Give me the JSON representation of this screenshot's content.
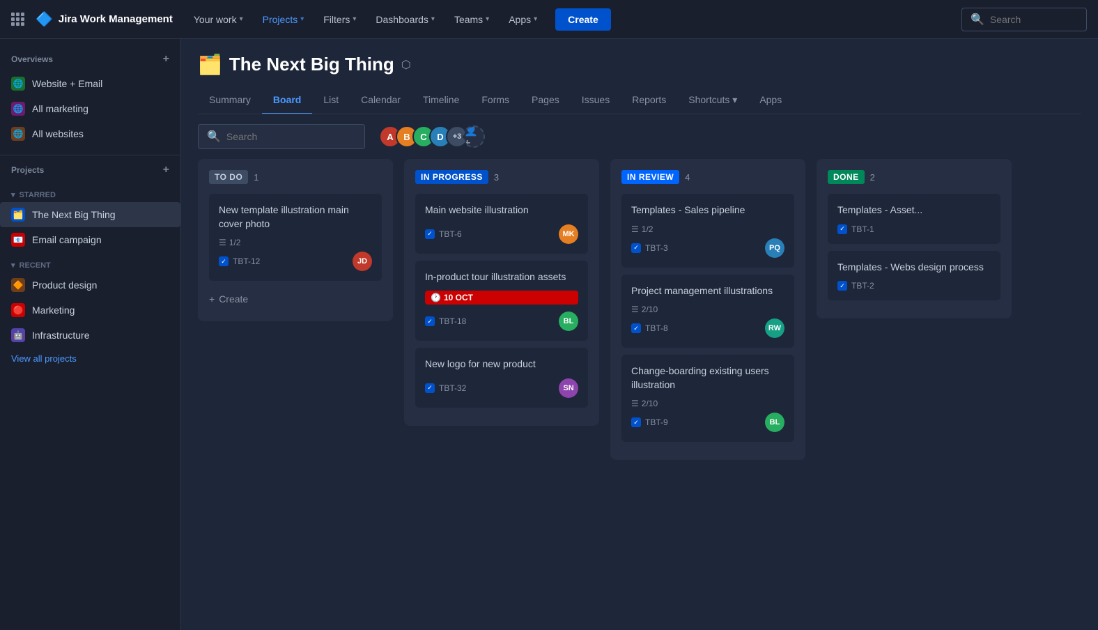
{
  "topnav": {
    "logo_text": "Jira Work Management",
    "nav_items": [
      {
        "label": "Your work",
        "active": false
      },
      {
        "label": "Projects",
        "active": true
      },
      {
        "label": "Filters",
        "active": false
      },
      {
        "label": "Dashboards",
        "active": false
      },
      {
        "label": "Teams",
        "active": false
      },
      {
        "label": "Apps",
        "active": false
      }
    ],
    "create_label": "Create",
    "search_placeholder": "Search"
  },
  "sidebar": {
    "overviews_title": "Overviews",
    "items_overviews": [
      {
        "label": "Website + Email",
        "icon": "🌐",
        "color": "icon-green"
      },
      {
        "label": "All marketing",
        "icon": "🌐",
        "color": "icon-pink"
      },
      {
        "label": "All websites",
        "icon": "🌐",
        "color": "icon-orange"
      }
    ],
    "projects_title": "Projects",
    "starred_label": "STARRED",
    "starred_items": [
      {
        "label": "The Next Big Thing",
        "icon": "🗂️",
        "color": "icon-blue"
      },
      {
        "label": "Email campaign",
        "icon": "📧",
        "color": "icon-red"
      }
    ],
    "recent_label": "RECENT",
    "recent_items": [
      {
        "label": "Product design",
        "icon": "🔶",
        "color": "icon-orange"
      },
      {
        "label": "Marketing",
        "icon": "🔴",
        "color": "icon-red"
      },
      {
        "label": "Infrastructure",
        "icon": "🤖",
        "color": "icon-purple"
      }
    ],
    "view_all_label": "View all projects"
  },
  "project": {
    "emoji": "🗂️",
    "title": "The Next Big Thing",
    "tabs": [
      {
        "label": "Summary",
        "active": false
      },
      {
        "label": "Board",
        "active": true
      },
      {
        "label": "List",
        "active": false
      },
      {
        "label": "Calendar",
        "active": false
      },
      {
        "label": "Timeline",
        "active": false
      },
      {
        "label": "Forms",
        "active": false
      },
      {
        "label": "Pages",
        "active": false
      },
      {
        "label": "Issues",
        "active": false
      },
      {
        "label": "Reports",
        "active": false
      },
      {
        "label": "Shortcuts",
        "active": false
      },
      {
        "label": "Apps",
        "active": false
      }
    ]
  },
  "board": {
    "search_placeholder": "Search",
    "columns": [
      {
        "label": "TO DO",
        "style": "label-todo",
        "count": "1",
        "cards": [
          {
            "title": "New template illustration main cover photo",
            "subtask": "1/2",
            "ticket_id": "TBT-12",
            "avatar_color": "av1",
            "avatar_initials": "JD"
          }
        ],
        "create_label": "Create"
      },
      {
        "label": "IN PROGRESS",
        "style": "label-inprogress",
        "count": "3",
        "cards": [
          {
            "title": "Main website illustration",
            "subtask": null,
            "ticket_id": "TBT-6",
            "avatar_color": "av2",
            "avatar_initials": "MK"
          },
          {
            "title": "In-product tour illustration assets",
            "subtask": null,
            "due": "10 OCT",
            "ticket_id": "TBT-18",
            "avatar_color": "av3",
            "avatar_initials": "BL"
          },
          {
            "title": "New logo for new product",
            "subtask": null,
            "ticket_id": "TBT-32",
            "avatar_color": "av5",
            "avatar_initials": "SN"
          }
        ],
        "create_label": null
      },
      {
        "label": "IN REVIEW",
        "style": "label-inreview",
        "count": "4",
        "cards": [
          {
            "title": "Templates - Sales pipeline",
            "subtask": "1/2",
            "ticket_id": "TBT-3",
            "avatar_color": "av4",
            "avatar_initials": "PQ"
          },
          {
            "title": "Project management illustrations",
            "subtask": "2/10",
            "ticket_id": "TBT-8",
            "avatar_color": "av6",
            "avatar_initials": "RW"
          },
          {
            "title": "Change-boarding existing users illustration",
            "subtask": "2/10",
            "ticket_id": "TBT-9",
            "avatar_color": "av3",
            "avatar_initials": "BL"
          }
        ],
        "create_label": null
      },
      {
        "label": "DONE",
        "style": "label-done",
        "count": "2",
        "cards": [
          {
            "title": "Templates - Asset...",
            "subtask": null,
            "ticket_id": "TBT-1",
            "avatar_color": null,
            "avatar_initials": null
          },
          {
            "title": "Templates - Webs design process",
            "subtask": null,
            "ticket_id": "TBT-2",
            "avatar_color": null,
            "avatar_initials": null
          }
        ],
        "create_label": null
      }
    ],
    "avatars": [
      {
        "initials": "A",
        "color": "av1"
      },
      {
        "initials": "B",
        "color": "av2"
      },
      {
        "initials": "C",
        "color": "av3"
      },
      {
        "initials": "D",
        "color": "av4"
      },
      {
        "count": "+3"
      }
    ]
  }
}
